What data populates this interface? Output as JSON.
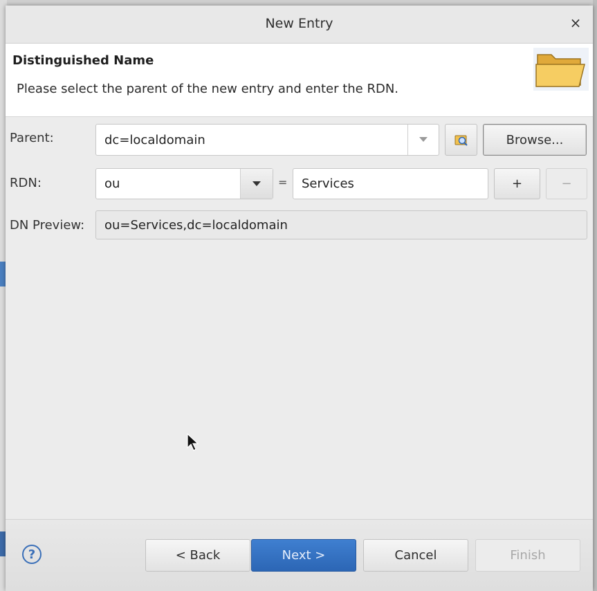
{
  "dialog": {
    "title": "New Entry",
    "close_glyph": "×"
  },
  "header": {
    "title": "Distinguished Name",
    "description": "Please select the parent of the new entry and enter the RDN.",
    "icon": "folder-icon"
  },
  "form": {
    "parent": {
      "label": "Parent:",
      "value": "dc=localdomain",
      "browse_label": "Browse..."
    },
    "rdn": {
      "label": "RDN:",
      "attribute": "ou",
      "equals": "=",
      "value": "Services",
      "add_label": "+",
      "remove_label": "−"
    },
    "dn_preview": {
      "label": "DN Preview:",
      "value": "ou=Services,dc=localdomain"
    }
  },
  "footer": {
    "help_label": "?",
    "back_label": "< Back",
    "next_label": "Next >",
    "cancel_label": "Cancel",
    "finish_label": "Finish"
  },
  "colors": {
    "primary_button": "#2c66b5",
    "help_icon": "#3a6fb8",
    "folder": "#f2c14e"
  }
}
